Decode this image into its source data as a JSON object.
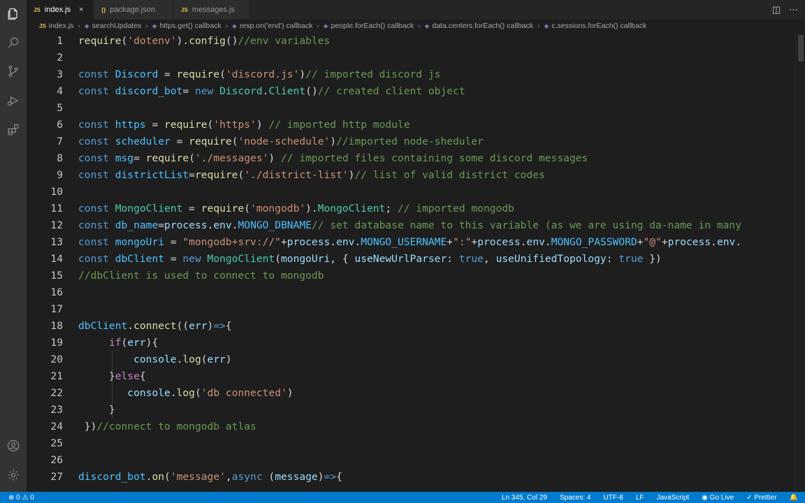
{
  "tabs": [
    {
      "icon": "JS",
      "label": "index.js",
      "active": true
    },
    {
      "icon": "{}",
      "label": "package.json"
    },
    {
      "icon": "JS",
      "label": "messages.js"
    }
  ],
  "tab_close": "×",
  "breadcrumb": [
    "index.js",
    "searchUpdates",
    "https.get() callback",
    "resp.on('end') callback",
    "people.forEach() callback",
    "data.centers.forEach() callback",
    "c.sessions.forEach() callback"
  ],
  "lines": [
    {
      "n": "1"
    },
    {
      "n": "2"
    },
    {
      "n": "3"
    },
    {
      "n": "4"
    },
    {
      "n": "5"
    },
    {
      "n": "6"
    },
    {
      "n": "7"
    },
    {
      "n": "8"
    },
    {
      "n": "9"
    },
    {
      "n": "10"
    },
    {
      "n": "11"
    },
    {
      "n": "12"
    },
    {
      "n": "13"
    },
    {
      "n": "14"
    },
    {
      "n": "15"
    },
    {
      "n": "16"
    },
    {
      "n": "17"
    },
    {
      "n": "18"
    },
    {
      "n": "19"
    },
    {
      "n": "20"
    },
    {
      "n": "21"
    },
    {
      "n": "22"
    },
    {
      "n": "23"
    },
    {
      "n": "24"
    },
    {
      "n": "25"
    },
    {
      "n": "26"
    },
    {
      "n": "27"
    }
  ],
  "status": {
    "problems": "⊗ 0 ⚠ 0",
    "position": "Ln 345, Col 29",
    "spaces": "Spaces: 4",
    "encoding": "UTF-8",
    "eol": "LF",
    "language": "JavaScript",
    "golive": "Go Live",
    "prettier": "Prettier"
  }
}
